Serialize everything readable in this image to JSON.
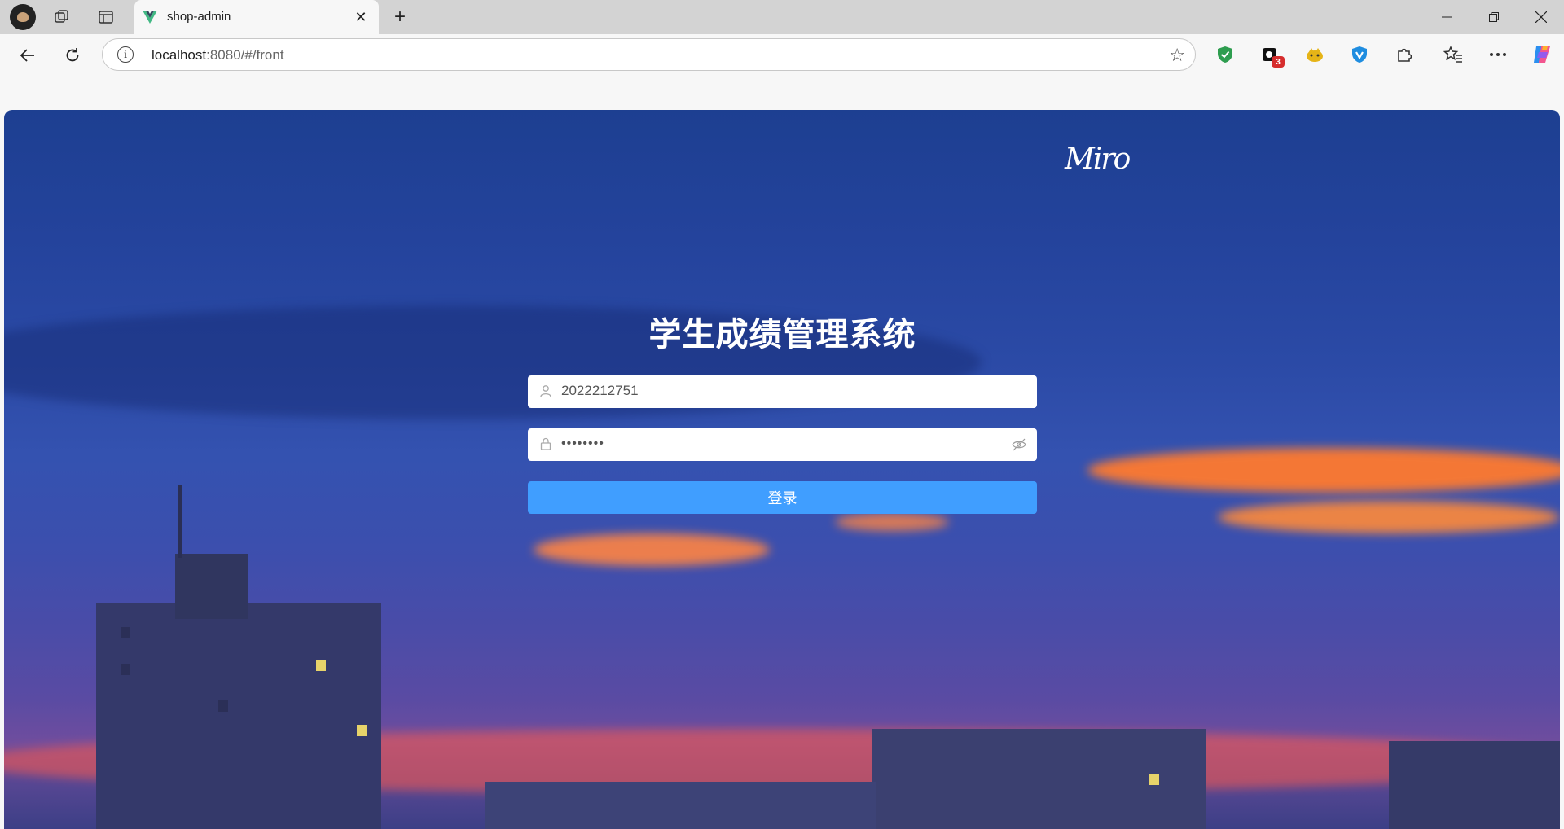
{
  "browser": {
    "tab_title": "shop-admin",
    "url_host": "localhost",
    "url_rest": ":8080/#/front",
    "extension_badge": "3"
  },
  "page": {
    "signature": "Miro",
    "title": "学生成绩管理系统",
    "username_value": "2022212751",
    "password_value": "••••••••",
    "login_label": "登录",
    "colors": {
      "button": "#409eff",
      "sky_top": "#1d3f91",
      "cloud_orange": "#ff7a2f"
    }
  }
}
